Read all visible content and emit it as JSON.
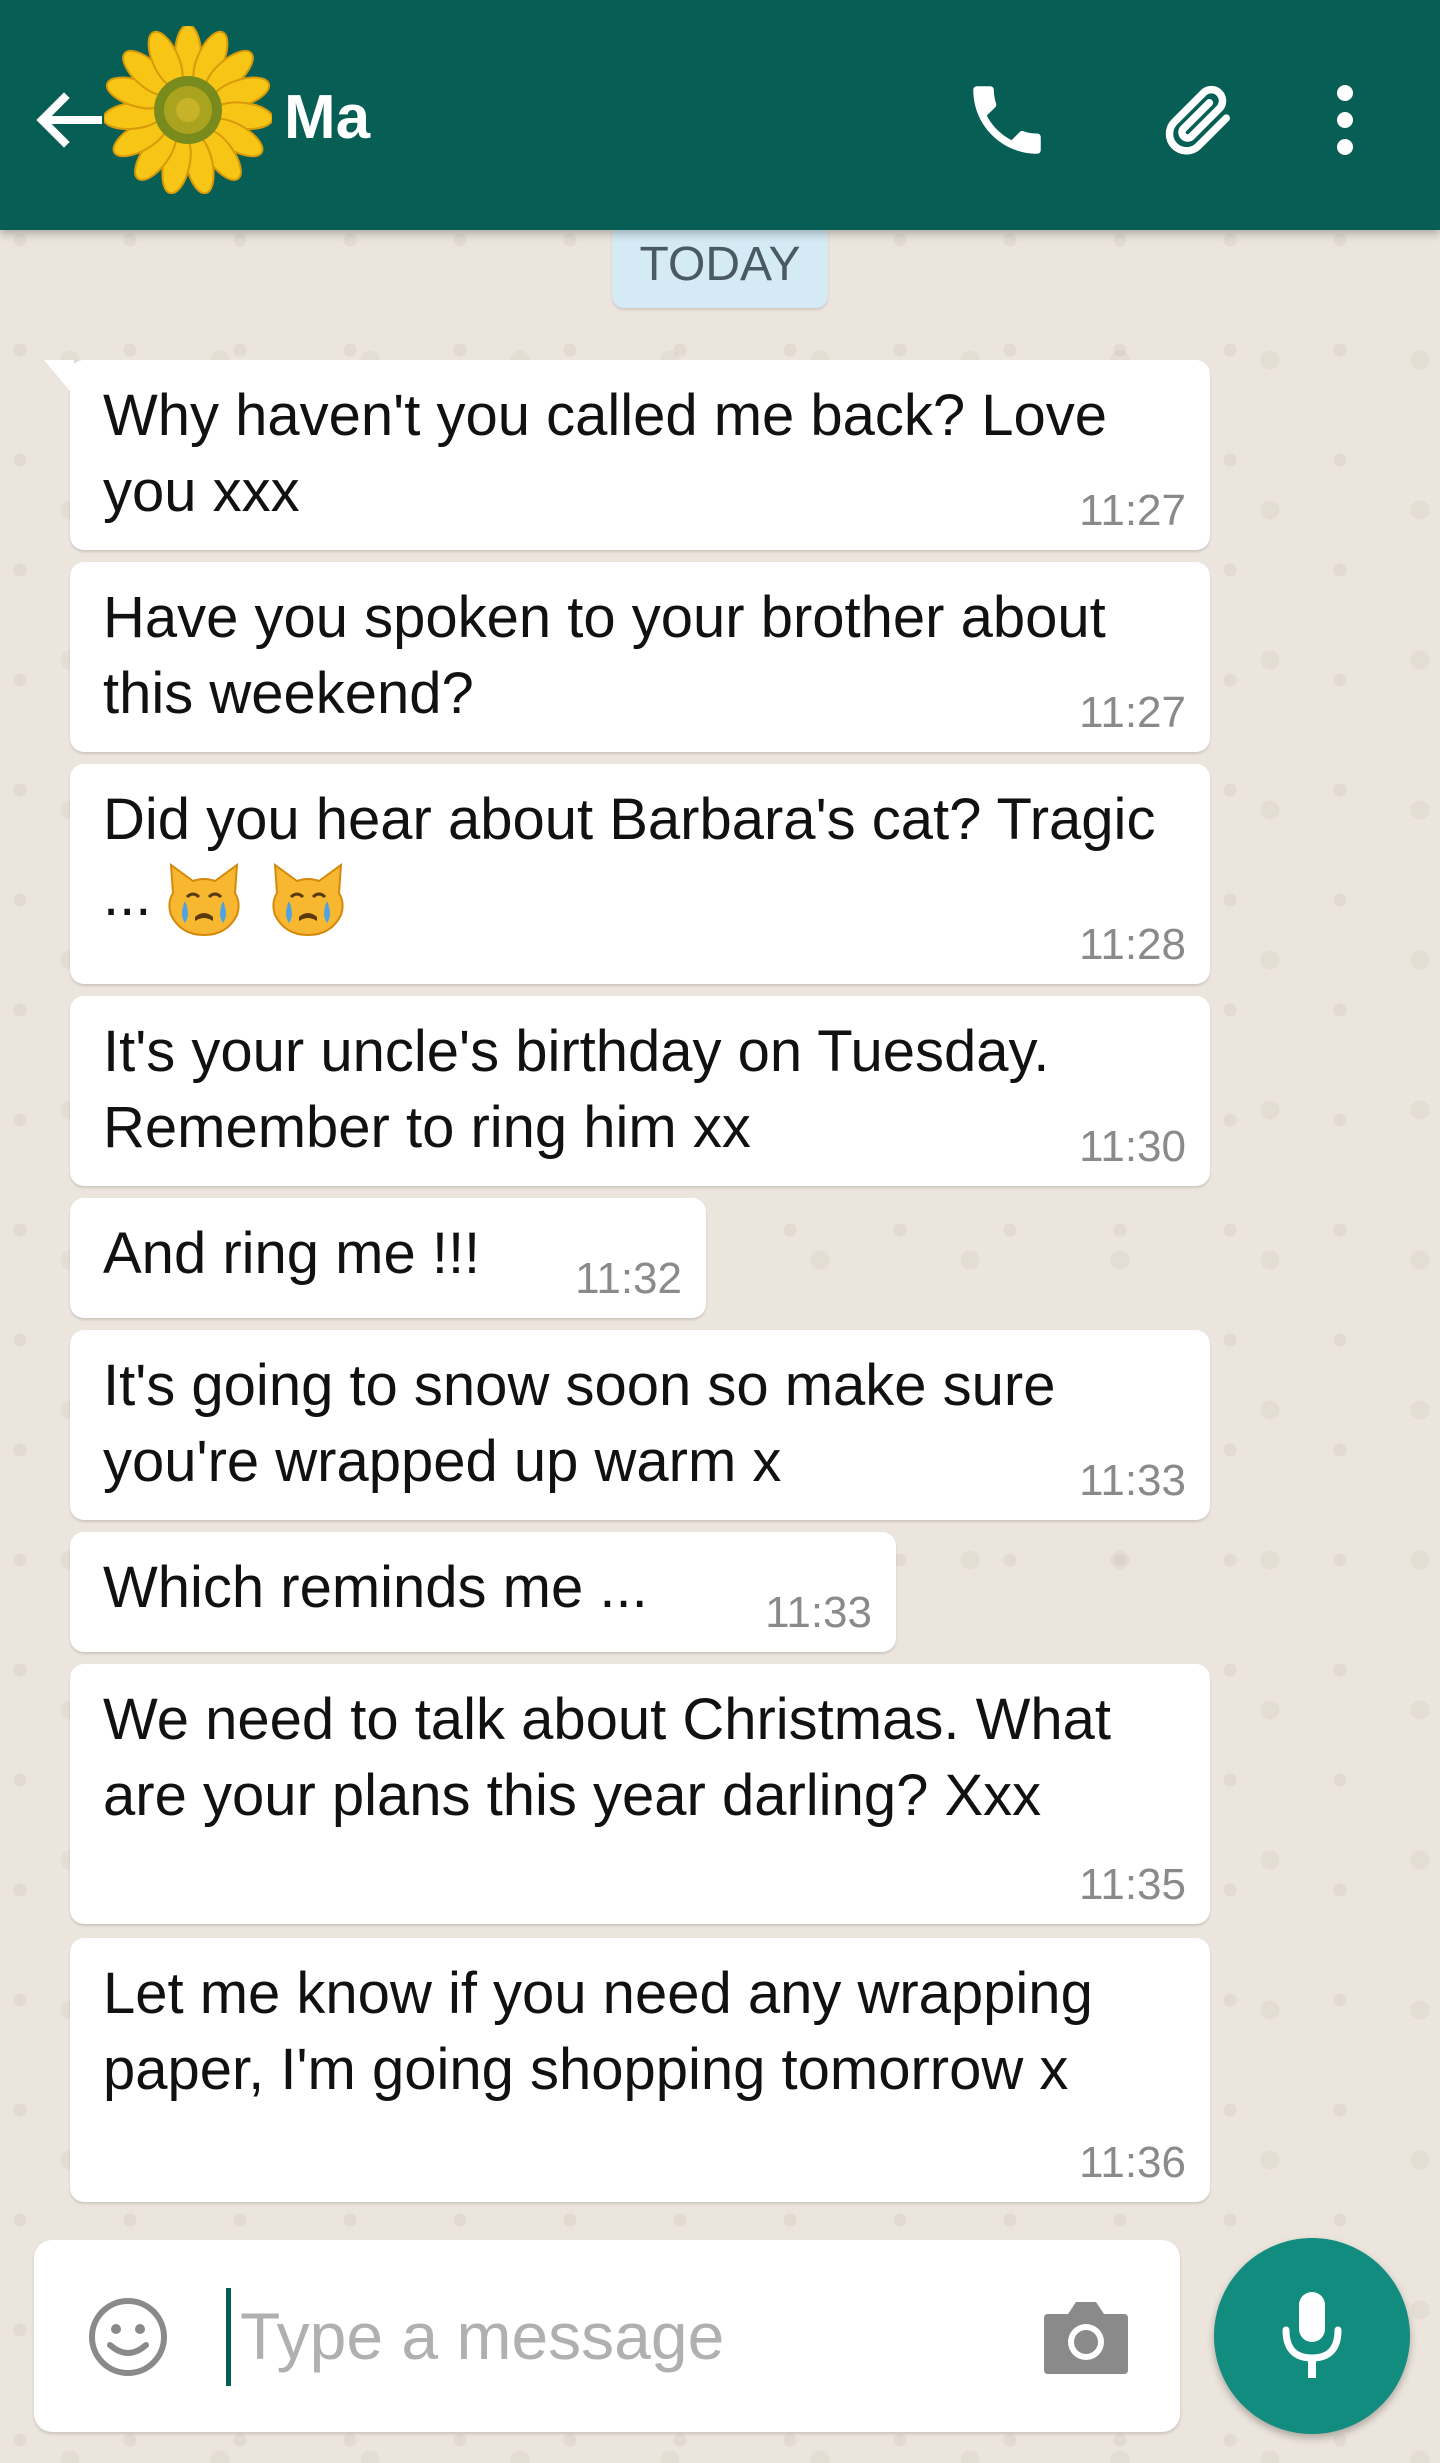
{
  "header": {
    "contact_name": "Ma",
    "back_icon": "arrow-left-icon",
    "avatar_icon": "sunflower-avatar",
    "call_icon": "phone-icon",
    "attach_icon": "paperclip-icon",
    "menu_icon": "more-vertical-icon",
    "bg_color": "#075E54"
  },
  "date_divider": "TODAY",
  "messages": [
    {
      "text": "Why haven't you called me back? Love you xxx",
      "time": "11:27"
    },
    {
      "text": "Have you spoken to your brother about this weekend?",
      "time": "11:27"
    },
    {
      "text": "Did you hear about Barbara's cat? Tragic ...",
      "emoji": [
        "crying-cat-emoji",
        "crying-cat-emoji"
      ],
      "time": "11:28"
    },
    {
      "text": "It's your uncle's birthday on Tuesday. Remember to ring him xx",
      "time": "11:30"
    },
    {
      "text": "And ring me !!!",
      "time": "11:32"
    },
    {
      "text": "It's going to snow soon so make sure you're wrapped up warm x",
      "time": "11:33"
    },
    {
      "text": "Which reminds me ...",
      "time": "11:33"
    },
    {
      "text": "We need to talk about Christmas. What are your plans this year darling? Xxx",
      "time": "11:35"
    },
    {
      "text": "Let me know if you need any wrapping paper, I'm going shopping tomorrow x",
      "time": "11:36"
    }
  ],
  "composer": {
    "placeholder": "Type a message",
    "emoji_icon": "smiley-icon",
    "camera_icon": "camera-icon",
    "mic_icon": "microphone-icon",
    "accent_color": "#128C7E"
  }
}
